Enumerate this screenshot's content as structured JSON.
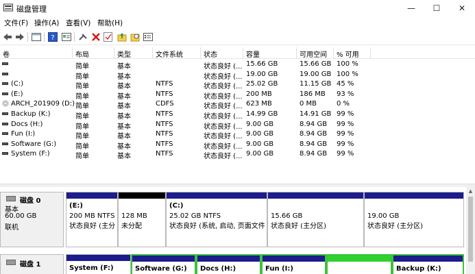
{
  "window": {
    "title": "磁盘管理",
    "controls": {
      "minimize": "—",
      "maximize": "☐",
      "close": "✕"
    }
  },
  "menu": [
    "文件(F)",
    "操作(A)",
    "查看(V)",
    "帮助(H)"
  ],
  "table": {
    "headers": [
      "卷",
      "布局",
      "类型",
      "文件系统",
      "状态",
      "容量",
      "可用空间",
      "% 可用"
    ],
    "rows": [
      {
        "vol": "",
        "layout": "简单",
        "type": "基本",
        "fs": "",
        "status": "状态良好 (...",
        "cap": "15.66 GB",
        "free": "15.66 GB",
        "pct": "100 %",
        "icon": "volume-icon"
      },
      {
        "vol": "",
        "layout": "简单",
        "type": "基本",
        "fs": "",
        "status": "状态良好 (...",
        "cap": "19.00 GB",
        "free": "19.00 GB",
        "pct": "100 %",
        "icon": "volume-icon"
      },
      {
        "vol": "(C:)",
        "layout": "简单",
        "type": "基本",
        "fs": "NTFS",
        "status": "状态良好 (...",
        "cap": "25.02 GB",
        "free": "11.15 GB",
        "pct": "45 %",
        "icon": "volume-icon"
      },
      {
        "vol": "(E:)",
        "layout": "简单",
        "type": "基本",
        "fs": "NTFS",
        "status": "状态良好 (...",
        "cap": "200 MB",
        "free": "186 MB",
        "pct": "93 %",
        "icon": "volume-icon"
      },
      {
        "vol": "ARCH_201909 (D:)",
        "layout": "简单",
        "type": "基本",
        "fs": "CDFS",
        "status": "状态良好 (...",
        "cap": "623 MB",
        "free": "0 MB",
        "pct": "0 %",
        "icon": "cd-icon"
      },
      {
        "vol": "Backup (K:)",
        "layout": "简单",
        "type": "基本",
        "fs": "NTFS",
        "status": "状态良好 (...",
        "cap": "14.99 GB",
        "free": "14.91 GB",
        "pct": "99 %",
        "icon": "volume-icon"
      },
      {
        "vol": "Docs (H:)",
        "layout": "简单",
        "type": "基本",
        "fs": "NTFS",
        "status": "状态良好 (...",
        "cap": "9.00 GB",
        "free": "8.94 GB",
        "pct": "99 %",
        "icon": "volume-icon"
      },
      {
        "vol": "Fun (I:)",
        "layout": "简单",
        "type": "基本",
        "fs": "NTFS",
        "status": "状态良好 (...",
        "cap": "9.00 GB",
        "free": "8.94 GB",
        "pct": "99 %",
        "icon": "volume-icon"
      },
      {
        "vol": "Software (G:)",
        "layout": "简单",
        "type": "基本",
        "fs": "NTFS",
        "status": "状态良好 (...",
        "cap": "9.00 GB",
        "free": "8.94 GB",
        "pct": "99 %",
        "icon": "volume-icon"
      },
      {
        "vol": "System (F:)",
        "layout": "简单",
        "type": "基本",
        "fs": "NTFS",
        "status": "状态良好 (...",
        "cap": "9.00 GB",
        "free": "8.94 GB",
        "pct": "99 %",
        "icon": "volume-icon"
      }
    ]
  },
  "disks": [
    {
      "name": "磁盘 0",
      "kind": "基本",
      "size": "60.00 GB",
      "state": "联机",
      "partitions": [
        {
          "lines": [
            "(E:)",
            "200 MB NTFS",
            "状态良好 (主分"
          ],
          "bar": "blue"
        },
        {
          "lines": [
            "",
            "128 MB",
            "未分配"
          ],
          "bar": "black"
        },
        {
          "lines": [
            "(C:)",
            "25.02 GB NTFS",
            "状态良好 (系统, 启动, 页面文件"
          ],
          "bar": "blue"
        },
        {
          "lines": [
            "",
            "15.66 GB",
            "状态良好 (主分区)"
          ],
          "bar": "blue"
        },
        {
          "lines": [
            "",
            "19.00 GB",
            "状态良好 (主分区)"
          ],
          "bar": "blue"
        }
      ]
    },
    {
      "name": "磁盘 1",
      "partitions": [
        {
          "lines": [
            "System (F:)"
          ],
          "bar": "blue"
        },
        {
          "lines": [
            "Software (G:)"
          ],
          "bar": "blue"
        },
        {
          "lines": [
            "Docs (H:)"
          ],
          "bar": "blue"
        },
        {
          "lines": [
            "Fun (I:)"
          ],
          "bar": "blue"
        },
        {
          "lines": [
            ""
          ],
          "bar": "green"
        },
        {
          "lines": [
            "Backup (K:)"
          ],
          "bar": "blue"
        }
      ]
    }
  ],
  "colors": {
    "primary_partition": "#1c1c8c",
    "unallocated": "#000000",
    "free_space": "#2ed12e"
  }
}
